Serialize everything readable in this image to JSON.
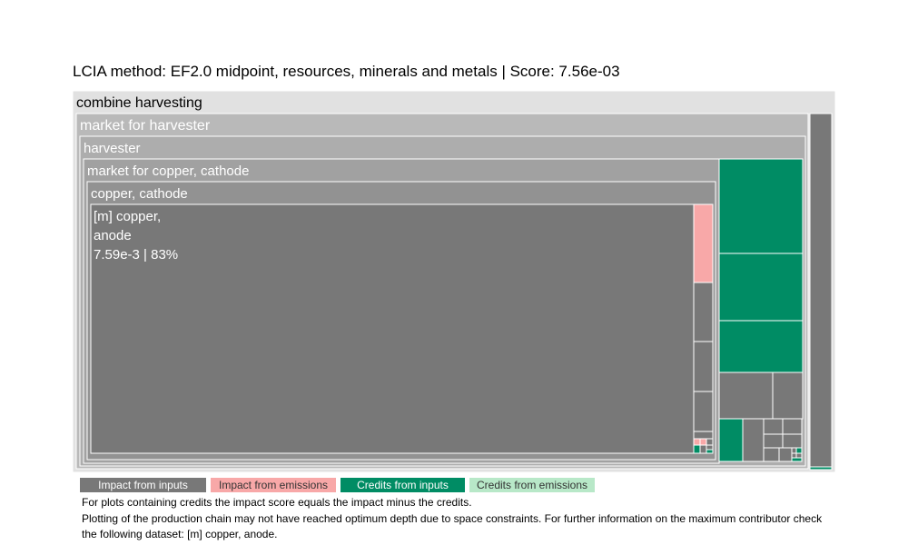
{
  "title": "LCIA method: EF2.0 midpoint, resources, minerals and metals | Score: 7.56e-03",
  "colors": {
    "impact_inputs": "#787878",
    "impact_emissions": "#f8a8a8",
    "credits_inputs": "#008c64",
    "credits_emissions": "#b8e8c8",
    "level0": "#e1e1e1",
    "level1": "#b9b9b9",
    "level2": "#adadad",
    "level3": "#a1a1a1",
    "level4": "#929292",
    "border": "#ffffff"
  },
  "legend": [
    {
      "label": "Impact from inputs",
      "color": "#787878",
      "text_color": "#ffffff"
    },
    {
      "label": "Impact from emissions",
      "color": "#f8a8a8",
      "text_color": "#333333"
    },
    {
      "label": "Credits from inputs",
      "color": "#008c64",
      "text_color": "#ffffff"
    },
    {
      "label": "Credits from emissions",
      "color": "#b8e8c8",
      "text_color": "#333333"
    }
  ],
  "notes": [
    "For plots containing credits the impact score equals the impact minus the credits.",
    "Plotting of the production chain may not have reached optimum depth due to space constraints. For further information on the maximum contributor check the following dataset: [m] copper, anode."
  ],
  "chart_data": {
    "type": "treemap",
    "method": "EF2.0 midpoint, resources, minerals and metals",
    "score": "7.56e-03",
    "hierarchy": [
      "combine harvesting",
      "market for harvester",
      "harvester",
      "market for copper, cathode",
      "copper, cathode"
    ],
    "top_contributor": {
      "name": "[m] copper, anode",
      "value": "7.59e-3",
      "share": "83%",
      "name_lines": [
        "[m] copper,",
        "anode"
      ]
    },
    "labels": {
      "level0": "combine harvesting",
      "level1": "market for harvester",
      "level2": "harvester",
      "level3": "market for copper, cathode",
      "level4": "copper, cathode"
    }
  }
}
